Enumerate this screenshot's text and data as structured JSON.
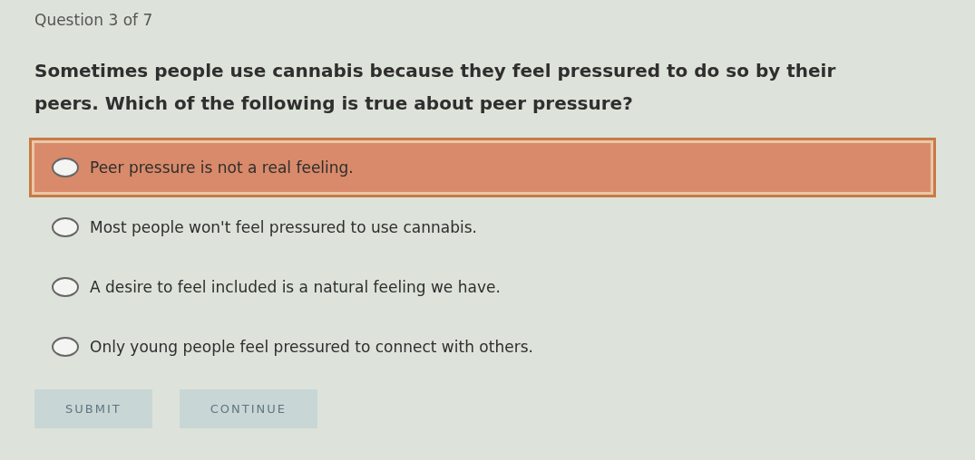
{
  "header": {
    "counter": "Question 3 of 7"
  },
  "question": {
    "text": "Sometimes people use cannabis because they feel pressured to do so by their peers. Which of the following is true about peer pressure?"
  },
  "options": [
    {
      "label": "Peer pressure is not a real feeling.",
      "selected": false,
      "highlighted": true
    },
    {
      "label": "Most people won't feel pressured to use cannabis.",
      "selected": false,
      "highlighted": false
    },
    {
      "label": "A desire to feel included is a natural feeling we have.",
      "selected": false,
      "highlighted": false
    },
    {
      "label": "Only young people feel pressured to connect with others.",
      "selected": false,
      "highlighted": false
    }
  ],
  "buttons": [
    {
      "label": "SUBMIT",
      "disabled": true
    },
    {
      "label": "CONTINUE",
      "disabled": true
    }
  ]
}
